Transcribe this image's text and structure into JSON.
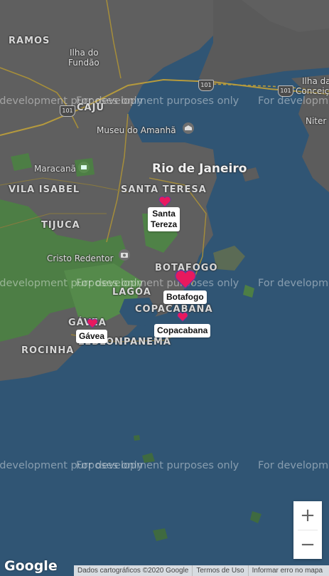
{
  "map": {
    "city_label": "Rio de Janeiro",
    "neighborhoods": [
      "RAMOS",
      "CAJU",
      "VILA ISABEL",
      "SANTA TERESA",
      "TIJUCA",
      "BOTAFOGO",
      "LAGOA",
      "COPACABANA",
      "GÁVEA",
      "ROCINHA",
      "LEBLON",
      "IPANEMA"
    ],
    "places": [
      "Ilha do",
      "Fundão",
      "Museu do Amanhã",
      "Maracanã",
      "Cristo Redentor",
      "Ilha da",
      "Conceiç",
      "Niter"
    ],
    "route_shields": [
      "101",
      "101",
      "101"
    ],
    "dev_watermark": "For development purposes only",
    "colors": {
      "water": "#305574",
      "land": "#5f5f5f",
      "park": "#4d7e45",
      "marker": "#e8195e"
    }
  },
  "markers": [
    {
      "label_line1": "Santa",
      "label_line2": "Tereza",
      "icon": "heart-icon"
    },
    {
      "label_line1": "Botafogo",
      "icon": "heart-icon"
    },
    {
      "label_line1": "Copacabana",
      "icon": "heart-icon"
    },
    {
      "label_line1": "Gávea",
      "icon": "heart-icon"
    }
  ],
  "controls": {
    "zoom_in": "+",
    "zoom_out": "−"
  },
  "branding": {
    "logo": "Google"
  },
  "footer": {
    "map_data": "Dados cartográficos ©2020 Google",
    "terms": "Termos de Uso",
    "report": "Informar erro no mapa"
  }
}
